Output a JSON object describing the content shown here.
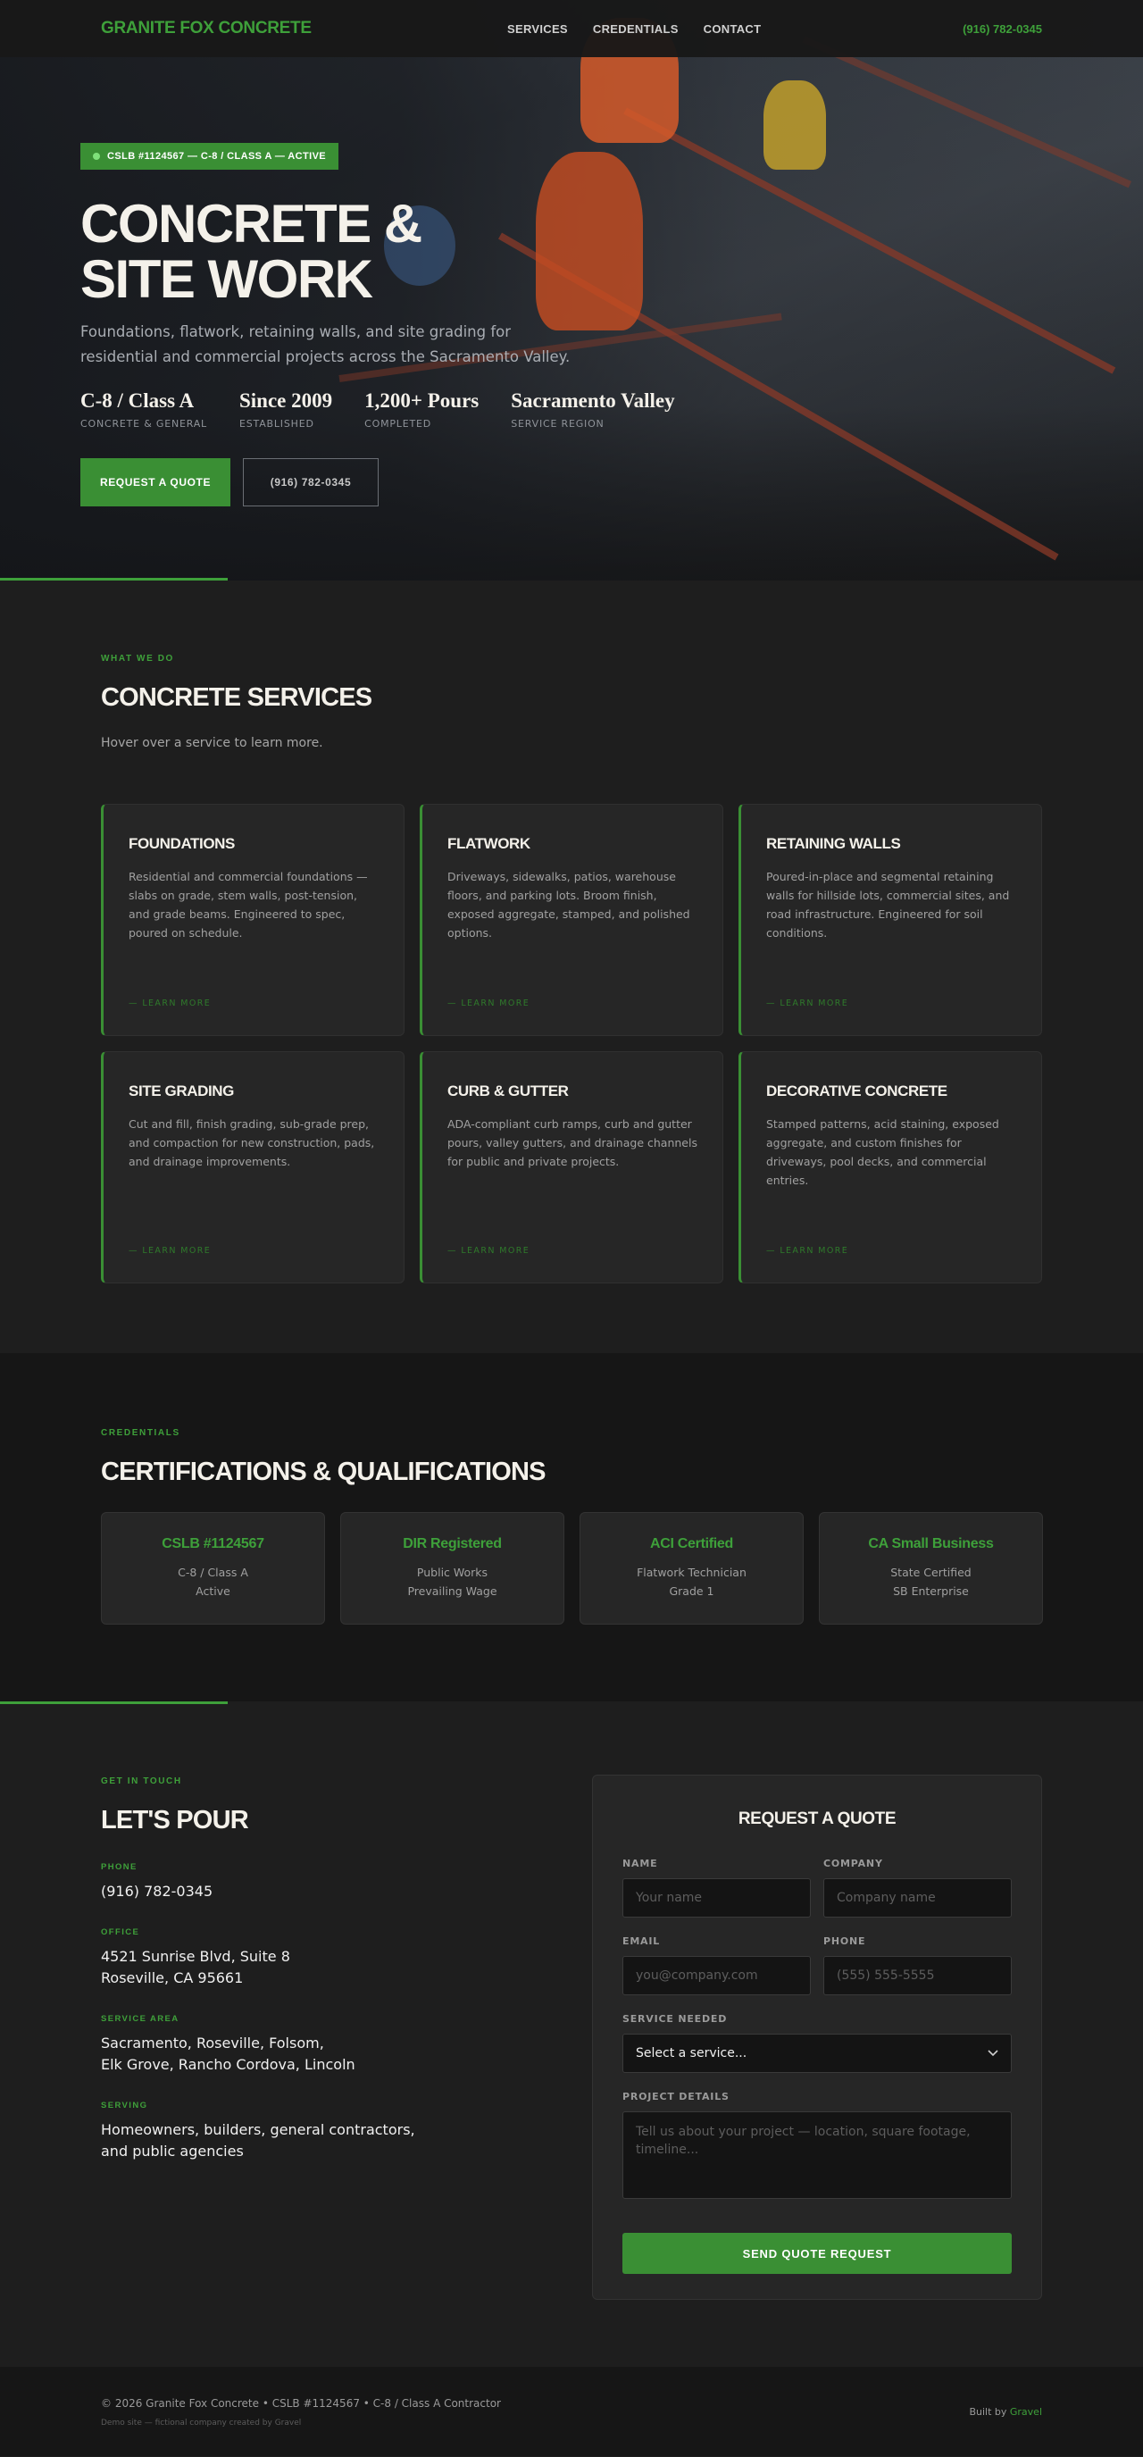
{
  "nav": {
    "logo": "GRANITE FOX CONCRETE",
    "links": [
      "SERVICES",
      "CREDENTIALS",
      "CONTACT"
    ],
    "phone": "(916) 782-0345"
  },
  "hero": {
    "badge": "CSLB #1124567 — C-8 / CLASS A — ACTIVE",
    "title_line1": "CONCRETE &",
    "title_line2": "SITE WORK",
    "subtitle": "Foundations, flatwork, retaining walls, and site grading for residential and commercial projects across the Sacramento Valley.",
    "stats": [
      {
        "value": "C-8 / Class A",
        "label": "CONCRETE & GENERAL"
      },
      {
        "value": "Since 2009",
        "label": "ESTABLISHED"
      },
      {
        "value": "1,200+ Pours",
        "label": "COMPLETED"
      },
      {
        "value": "Sacramento Valley",
        "label": "SERVICE REGION"
      }
    ],
    "primary_button": "REQUEST A QUOTE",
    "secondary_button": "(916) 782-0345"
  },
  "services": {
    "label": "WHAT WE DO",
    "title": "CONCRETE SERVICES",
    "intro": "Hover over a service to learn more.",
    "learn_more": "— LEARN MORE",
    "items": [
      {
        "title": "FOUNDATIONS",
        "desc": "Residential and commercial foundations — slabs on grade, stem walls, post-tension, and grade beams. Engineered to spec, poured on schedule."
      },
      {
        "title": "FLATWORK",
        "desc": "Driveways, sidewalks, patios, warehouse floors, and parking lots. Broom finish, exposed aggregate, stamped, and polished options."
      },
      {
        "title": "RETAINING WALLS",
        "desc": "Poured-in-place and segmental retaining walls for hillside lots, commercial sites, and road infrastructure. Engineered for soil conditions."
      },
      {
        "title": "SITE GRADING",
        "desc": "Cut and fill, finish grading, sub-grade prep, and compaction for new construction, pads, and drainage improvements."
      },
      {
        "title": "CURB & GUTTER",
        "desc": "ADA-compliant curb ramps, curb and gutter pours, valley gutters, and drainage channels for public and private projects."
      },
      {
        "title": "DECORATIVE CONCRETE",
        "desc": "Stamped patterns, acid staining, exposed aggregate, and custom finishes for driveways, pool decks, and commercial entries."
      }
    ]
  },
  "credentials": {
    "label": "CREDENTIALS",
    "title": "CERTIFICATIONS & QUALIFICATIONS",
    "items": [
      {
        "title": "CSLB #1124567",
        "line1": "C-8 / Class A",
        "line2": "Active"
      },
      {
        "title": "DIR Registered",
        "line1": "Public Works",
        "line2": "Prevailing Wage"
      },
      {
        "title": "ACI Certified",
        "line1": "Flatwork Technician",
        "line2": "Grade 1"
      },
      {
        "title": "CA Small Business",
        "line1": "State Certified",
        "line2": "SB Enterprise"
      }
    ]
  },
  "contact": {
    "label": "GET IN TOUCH",
    "title": "LET'S POUR",
    "phone_label": "PHONE",
    "phone": "(916) 782-0345",
    "office_label": "OFFICE",
    "office_line1": "4521 Sunrise Blvd, Suite 8",
    "office_line2": "Roseville, CA 95661",
    "area_label": "SERVICE AREA",
    "area_line1": "Sacramento, Roseville, Folsom,",
    "area_line2": "Elk Grove, Rancho Cordova, Lincoln",
    "serving_label": "SERVING",
    "serving_line1": "Homeowners, builders, general contractors,",
    "serving_line2": "and public agencies"
  },
  "form": {
    "title": "REQUEST A QUOTE",
    "name_label": "NAME",
    "name_placeholder": "Your name",
    "company_label": "COMPANY",
    "company_placeholder": "Company name",
    "email_label": "EMAIL",
    "email_placeholder": "you@company.com",
    "phone_label": "PHONE",
    "phone_placeholder": "(555) 555-5555",
    "service_label": "SERVICE NEEDED",
    "service_selected": "Select a service...",
    "details_label": "PROJECT DETAILS",
    "details_placeholder": "Tell us about your project — location, square footage, timeline...",
    "submit": "SEND QUOTE REQUEST"
  },
  "footer": {
    "copyright": "© 2026 Granite Fox Concrete • CSLB #1124567 • C-8 / Class A Contractor",
    "note": "Demo site — fictional company created by Gravel",
    "built_prefix": "Built by",
    "built_brand": "Gravel"
  },
  "colors": {
    "accent": "#3a8f34",
    "background": "#1e1e1e",
    "card": "#262626"
  }
}
